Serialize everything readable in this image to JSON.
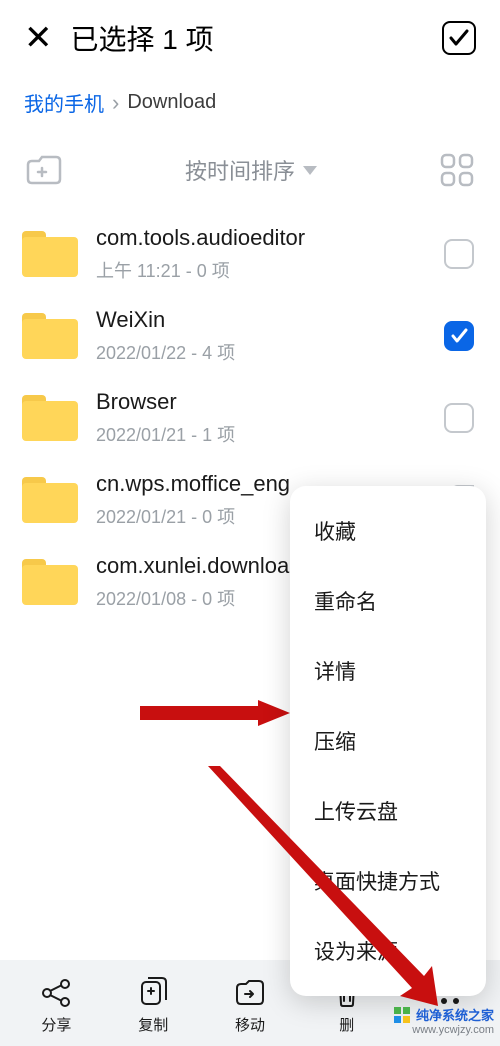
{
  "header": {
    "title": "已选择 1 项"
  },
  "breadcrumb": {
    "root": "我的手机",
    "current": "Download"
  },
  "toolbar": {
    "sort_label": "按时间排序"
  },
  "items": [
    {
      "name": "com.tools.audioeditor",
      "meta": "上午 11:21  - 0 项",
      "checked": false,
      "cut": false
    },
    {
      "name": "WeiXin",
      "meta": "2022/01/22 - 4 项",
      "checked": true,
      "cut": false
    },
    {
      "name": "Browser",
      "meta": "2022/01/21 - 1 项",
      "checked": false,
      "cut": false
    },
    {
      "name": "cn.wps.moffice_eng",
      "meta": "2022/01/21 - 0 项",
      "checked": false,
      "cut": true
    },
    {
      "name": "com.xunlei.download",
      "meta": "2022/01/08 - 0 项",
      "checked": false,
      "cut": true
    }
  ],
  "popup": {
    "items": [
      "收藏",
      "重命名",
      "详情",
      "压缩",
      "上传云盘",
      "桌面快捷方式",
      "设为来源"
    ]
  },
  "bottom": {
    "labels": [
      "分享",
      "复制",
      "移动",
      "删"
    ]
  },
  "watermark": {
    "line1": "纯净系统之家",
    "line2": "www.ycwjzy.com"
  },
  "colors": {
    "accent": "#0a66e6",
    "folder": "#ffd659",
    "arrow": "#c80f0f"
  }
}
